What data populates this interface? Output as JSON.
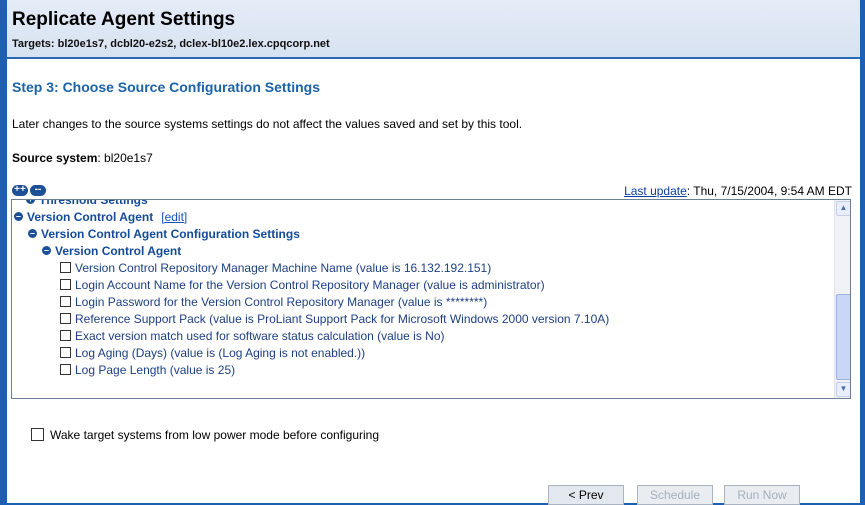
{
  "header": {
    "title": "Replicate Agent Settings",
    "targets": "Targets: bl20e1s7, dcbl20-e2s2, dclex-bl10e2.lex.cpqcorp.net"
  },
  "step_title": "Step 3: Choose Source Configuration Settings",
  "description": "Later changes to the source systems settings do not affect the values saved and set by this tool.",
  "source": {
    "label": "Source system",
    "value": ": bl20e1s7"
  },
  "expand_controls": {
    "expand_all": "++",
    "collapse_all": "--"
  },
  "last_update": {
    "link": "Last update",
    "value": ": Thu, 7/15/2004, 9:54 AM EDT"
  },
  "tree": {
    "threshold": "Threshold Settings",
    "vca": "Version Control Agent",
    "edit": "[edit]",
    "vca_config": "Version Control Agent Configuration Settings",
    "vca_sub": "Version Control Agent",
    "items": [
      "Version Control Repository Manager Machine Name (value is 16.132.192.151)",
      "Login Account Name for the Version Control Repository Manager (value is administrator)",
      "Login Password for the Version Control Repository Manager (value is ********)",
      "Reference Support Pack (value is ProLiant Support Pack for Microsoft Windows 2000 version 7.10A)",
      "Exact version match used for software status calculation (value is No)",
      "Log Aging (Days) (value is (Log Aging is not enabled.))",
      "Log Page Length (value is 25)"
    ]
  },
  "wake_label": "Wake target systems from low power mode before configuring",
  "buttons": {
    "prev": "< Prev",
    "schedule": "Schedule",
    "run_now": "Run Now"
  },
  "colors": {
    "accent_blue": "#1a63a9",
    "frame_blue": "#1f5fb3"
  }
}
